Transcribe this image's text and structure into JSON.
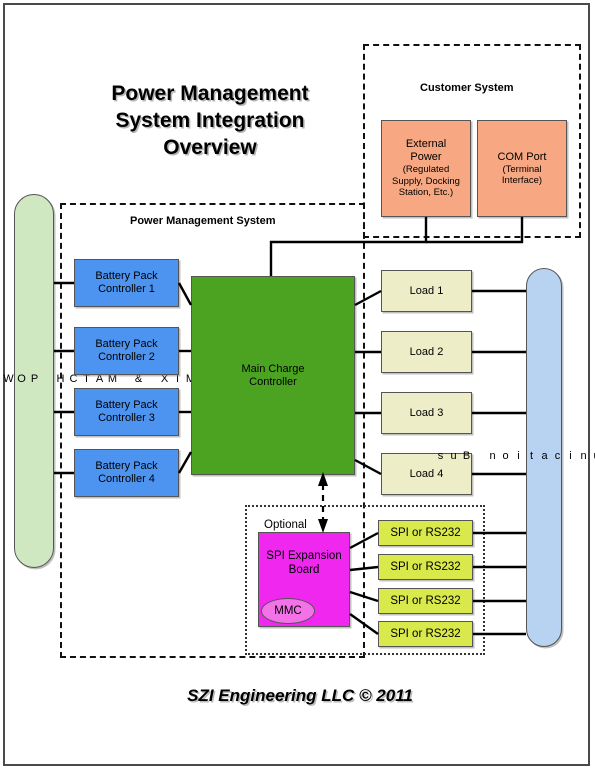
{
  "title": "Power Management\nSystem Integration\nOverview",
  "title_lines": [
    "Power Management",
    "System Integration",
    "Overview"
  ],
  "footer": "SZI Engineering LLC © 2011",
  "groups": {
    "power_management_system": "Power Management System",
    "customer_system": "Customer System",
    "optional": "Optional"
  },
  "sidebar": {
    "mix_match": "MIX & MATCH POWER SOURCES",
    "mix_match_vertical": "M\nI\nX\n\n&\n\nM\nA\nT\nC\nH\n\nP\nO\nW\nE\nR\n\nS\nO\nU\nR\nC\nE\nS"
  },
  "bus": {
    "communication_bus": "Communication Bus",
    "communication_bus_vertical": "C\no\nm\nm\nu\nn\ni\nc\na\nt\ni\no\nn\n\nB\nu\ns"
  },
  "battery_controllers": [
    {
      "line1": "Battery Pack",
      "line2": "Controller 1"
    },
    {
      "line1": "Battery Pack",
      "line2": "Controller 2"
    },
    {
      "line1": "Battery Pack",
      "line2": "Controller 3"
    },
    {
      "line1": "Battery Pack",
      "line2": "Controller 4"
    }
  ],
  "main_controller": {
    "line1": "Main Charge",
    "line2": "Controller"
  },
  "customer_blocks": [
    {
      "line1": "External",
      "line2": "Power",
      "sub1": "(Regulated",
      "sub2": "Supply, Docking",
      "sub3": "Station, Etc.)"
    },
    {
      "line1": "COM Port",
      "sub1": "(Terminal",
      "sub2": "Interface)"
    }
  ],
  "loads": [
    "Load 1",
    "Load 2",
    "Load 3",
    "Load 4"
  ],
  "expansion": {
    "board_line1": "SPI Expansion",
    "board_line2": "Board",
    "mmc": "MMC"
  },
  "spi_ports": [
    "SPI or RS232",
    "SPI or RS232",
    "SPI or RS232",
    "SPI or RS232"
  ],
  "colors": {
    "battery_blue": "#4d94f0",
    "main_green": "#4ca322",
    "external_salmon": "#f7a882",
    "load_yellow": "#edeec8",
    "spi_yellowgreen": "#d9e84a",
    "expansion_magenta": "#ef27ef",
    "mmc_pink": "#f472e8",
    "mix_match_green": "#cfe8c2",
    "bus_blue": "#b8d3f2",
    "border_gray": "#555555",
    "frame_gray": "#4a4a4a"
  }
}
